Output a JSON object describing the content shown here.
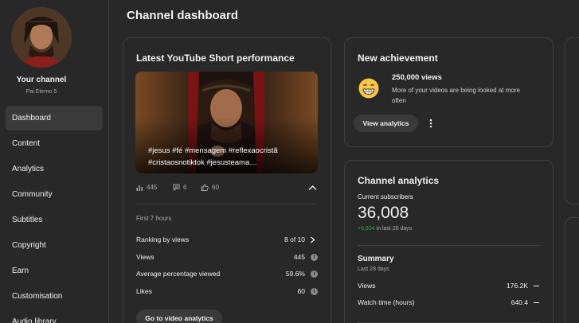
{
  "sidebar": {
    "your_channel": "Your channel",
    "channel_name": "Pai Eterno 5",
    "items": [
      {
        "label": "Dashboard",
        "active": true
      },
      {
        "label": "Content"
      },
      {
        "label": "Analytics"
      },
      {
        "label": "Community"
      },
      {
        "label": "Subtitles"
      },
      {
        "label": "Copyright"
      },
      {
        "label": "Earn"
      },
      {
        "label": "Customisation"
      },
      {
        "label": "Audio library"
      }
    ]
  },
  "page_title": "Channel dashboard",
  "short_card": {
    "title": "Latest YouTube Short performance",
    "caption": "#jesus #fé #mensagem #reflexaocristã #cristaosnotiktok #jesusteama…",
    "views": "445",
    "comments": "6",
    "likes": "60",
    "period": "First 7 hours",
    "rows": [
      {
        "label": "Ranking by views",
        "value": "8 of 10"
      },
      {
        "label": "Views",
        "value": "445"
      },
      {
        "label": "Average percentage viewed",
        "value": "59.6%"
      },
      {
        "label": "Likes",
        "value": "60"
      }
    ],
    "button": "Go to video analytics"
  },
  "achievement_card": {
    "title": "New achievement",
    "headline": "250,000 views",
    "description": "More of your videos are being looked at more often",
    "button": "View analytics"
  },
  "analytics_card": {
    "title": "Channel analytics",
    "subscribers_label": "Current subscribers",
    "subscribers_value": "36,008",
    "subscribers_delta": "+6,934",
    "subscribers_delta_period": "in last 28 days",
    "summary_title": "Summary",
    "summary_period": "Last 28 days",
    "rows": [
      {
        "label": "Views",
        "value": "176.2K"
      },
      {
        "label": "Watch time (hours)",
        "value": "640.4"
      }
    ]
  },
  "colors": {
    "background": "#282828",
    "card_border": "#3f3f3f",
    "positive": "#2ba640",
    "muted_text": "#aaaaaa"
  }
}
